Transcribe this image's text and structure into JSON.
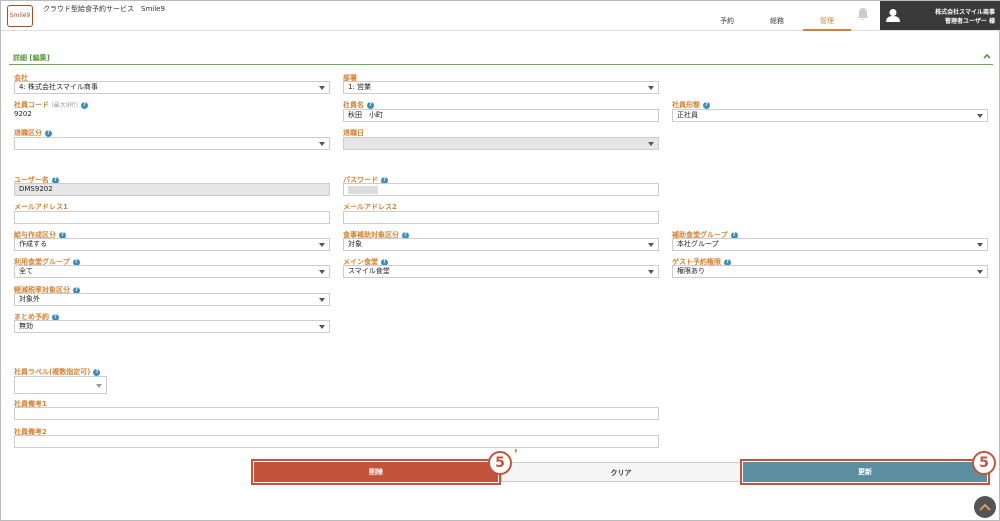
{
  "header": {
    "logo_text": "Smile9",
    "app_title": "クラウド型給食予約サービス　Smile9",
    "tabs": [
      "予約",
      "総務",
      "管理"
    ],
    "active_tab": "管理",
    "user_company": "株式会社スマイル商事",
    "user_name": "管理者ユーザー 様"
  },
  "section": {
    "title": "詳細 [編集]"
  },
  "form": {
    "company": {
      "label": "会社",
      "value": "4: 株式会社スマイル商事"
    },
    "department": {
      "label": "部署",
      "value": "1: 営業"
    },
    "employee_code": {
      "label": "社員コード",
      "hint": "(最大9桁)",
      "value": "9202"
    },
    "employee_name": {
      "label": "社員名",
      "value": "秋田　小町"
    },
    "employee_type": {
      "label": "社員形態",
      "value": "正社員"
    },
    "retire_status": {
      "label": "退職区分",
      "value": ""
    },
    "retire_date": {
      "label": "退職日",
      "value": ""
    },
    "username": {
      "label": "ユーザー名",
      "value": "DMS9202"
    },
    "password": {
      "label": "パスワード",
      "value": ""
    },
    "email1": {
      "label": "メールアドレス1",
      "value": ""
    },
    "email2": {
      "label": "メールアドレス2",
      "value": ""
    },
    "salary_create": {
      "label": "給与作成区分",
      "value": "作成する"
    },
    "meal_subsidy": {
      "label": "食事補助対象区分",
      "value": "対象"
    },
    "aux_group": {
      "label": "補助食堂グループ",
      "value": "本社グループ"
    },
    "use_group": {
      "label": "利用食堂グループ",
      "value": "全て"
    },
    "main_dining": {
      "label": "メイン食堂",
      "value": "スマイル食堂"
    },
    "guest_perm": {
      "label": "ゲスト予約権限",
      "value": "権限あり"
    },
    "reduced_tax": {
      "label": "軽減税率対象区分",
      "value": "対象外"
    },
    "bulk_reserve": {
      "label": "まとめ予約",
      "value": "無効"
    },
    "employee_label": {
      "label": "社員ラベル(複数指定可)",
      "value": ""
    },
    "note1": {
      "label": "社員備考1",
      "value": ""
    },
    "note2": {
      "label": "社員備考2",
      "value": ""
    }
  },
  "buttons": {
    "delete": "削除",
    "clear": "クリア",
    "update": "更新"
  },
  "annotations": {
    "delete_badge": "5",
    "delete_badge_prime": "'",
    "update_badge": "5"
  }
}
